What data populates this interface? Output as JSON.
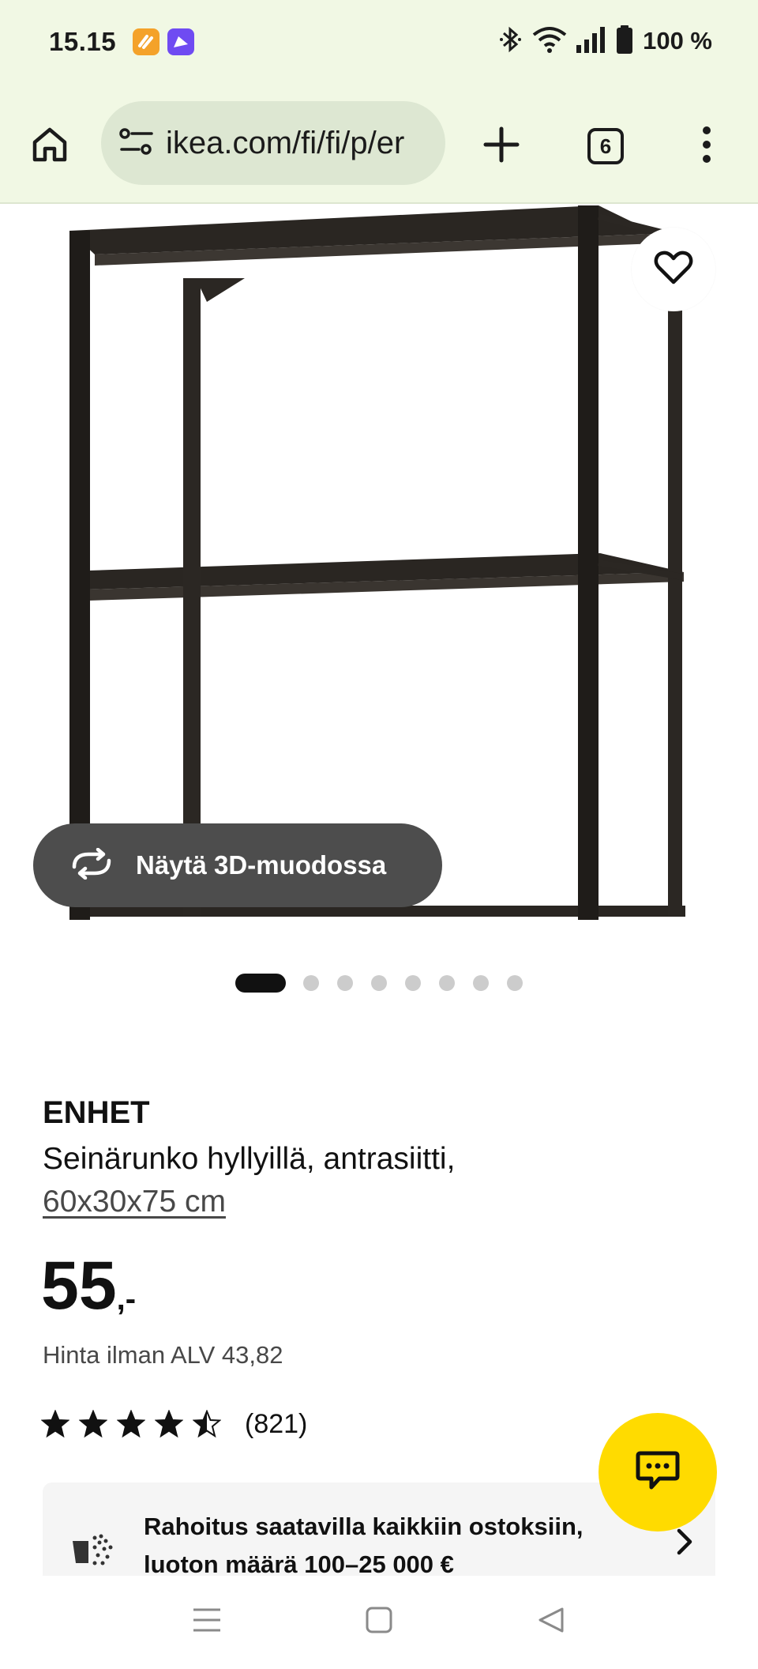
{
  "status_bar": {
    "time": "15.15",
    "battery": "100 %",
    "icons": [
      "orange-app-icon",
      "purple-app-icon",
      "bluetooth-icon",
      "wifi-icon",
      "signal-icon",
      "battery-icon"
    ]
  },
  "browser": {
    "url": "ikea.com/fi/fi/p/er",
    "tab_count": "6",
    "icons": [
      "home-icon",
      "site-info-icon",
      "plus-icon",
      "tabs-icon",
      "more-vert-icon"
    ]
  },
  "gallery": {
    "view_3d_label": "Näytä 3D-muodossa",
    "total_images": 8,
    "active_index": 0
  },
  "product": {
    "name": "ENHET",
    "description": "Seinärunko hyllyillä, antrasiitti,",
    "size": "60x30x75 cm",
    "price_main": "55",
    "price_suffix": ",-",
    "price_excl_vat": "Hinta ilman ALV 43,82",
    "rating": 4.5,
    "review_count": "(821)"
  },
  "financing": {
    "text": "Rahoitus saatavilla kaikkiin ostoksiin, luoton määrä 100–25 000 €"
  },
  "colors": {
    "chrome_bg": "#f1f8e4",
    "url_pill": "#dde7d2",
    "chat_yellow": "#ffdb00",
    "view3d_bg": "#4d4d4d"
  }
}
